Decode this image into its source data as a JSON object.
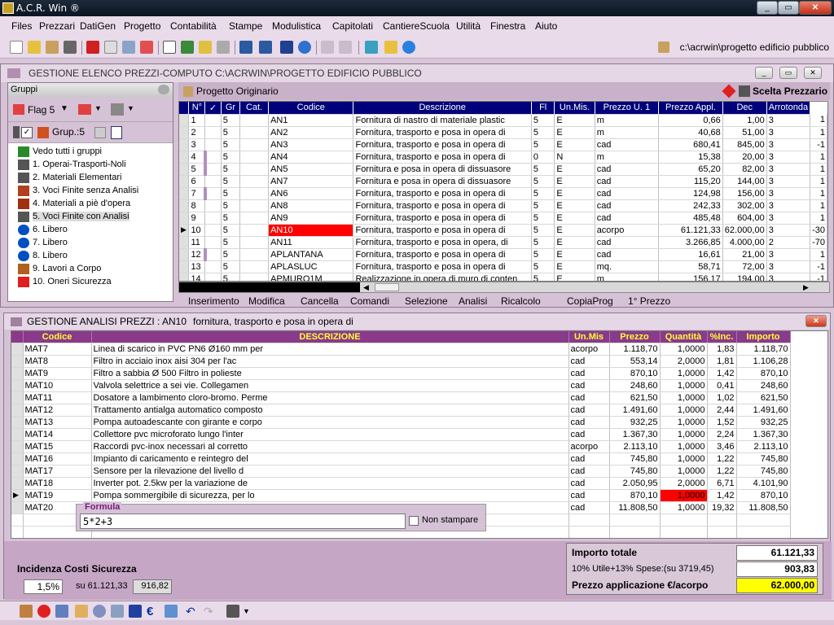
{
  "app": {
    "title": "A.C.R. Win  ®",
    "path": "c:\\acrwin\\progetto edificio pubblico"
  },
  "menu": [
    "Files",
    "Prezzari",
    "DatiGen",
    "Progetto",
    "Contabilità",
    "Stampe",
    "Modulistica",
    "Capitolati",
    "CantiereScuola",
    "Utilità",
    "Finestra",
    "Aiuto"
  ],
  "elenco": {
    "title": "GESTIONE ELENCO PREZZI-COMPUTO C:\\ACRWIN\\PROGETTO EDIFICIO PUBBLICO",
    "gruppi_label": "Gruppi",
    "flag_label": "Flag 5",
    "grup_label": "Grup.:5",
    "progetto_label": "Progetto Originario",
    "scelta_label": "Scelta Prezzario",
    "tree": [
      "Vedo tutti i gruppi",
      "1. Operai-Trasporti-Noli",
      "2. Materiali Elementari",
      "3. Voci Finite senza Analisi",
      "4. Materiali a piè d'opera",
      "5. Voci Finite con Analisi",
      "6. Libero",
      "7. Libero",
      "8. Libero",
      "9. Lavori a Corpo",
      "10. Oneri Sicurezza"
    ],
    "columns": [
      "N°",
      "✓",
      "Gr",
      "Cat.",
      "Codice",
      "Descrizione",
      "Fl",
      "Un.Mis.",
      "Prezzo U. 1",
      "Prezzo Appl.",
      "Dec",
      "Arrotonda"
    ],
    "rows": [
      [
        "1",
        "5",
        "AN1",
        "Fornitura di nastro di materiale plastic",
        "5",
        "E",
        "m",
        "0,66",
        "1,00",
        "3",
        "1"
      ],
      [
        "2",
        "5",
        "AN2",
        "Fornitura, trasporto e posa in opera di",
        "5",
        "E",
        "m",
        "40,68",
        "51,00",
        "3",
        "1"
      ],
      [
        "3",
        "5",
        "AN3",
        "Fornitura, trasporto e posa in opera di",
        "5",
        "E",
        "cad",
        "680,41",
        "845,00",
        "3",
        "-1"
      ],
      [
        "4",
        "5",
        "AN4",
        "Fornitura, trasporto e posa in opera di",
        "0",
        "N",
        "m",
        "15,38",
        "20,00",
        "3",
        "1"
      ],
      [
        "5",
        "5",
        "AN5",
        "Fornitura e posa in opera di dissuasore",
        "5",
        "E",
        "cad",
        "65,20",
        "82,00",
        "3",
        "1"
      ],
      [
        "6",
        "5",
        "AN7",
        "Fornitura e posa in opera di dissuasore",
        "5",
        "E",
        "cad",
        "115,20",
        "144,00",
        "3",
        "1"
      ],
      [
        "7",
        "5",
        "AN6",
        "Fornitura, trasporto e posa in opera di",
        "5",
        "E",
        "cad",
        "124,98",
        "156,00",
        "3",
        "1"
      ],
      [
        "8",
        "5",
        "AN8",
        "Fornitura, trasporto e posa in opera di",
        "5",
        "E",
        "cad",
        "242,33",
        "302,00",
        "3",
        "1"
      ],
      [
        "9",
        "5",
        "AN9",
        "Fornitura, trasporto e posa in opera di",
        "5",
        "E",
        "cad",
        "485,48",
        "604,00",
        "3",
        "1"
      ],
      [
        "10",
        "5",
        "AN10",
        "Fornitura, trasporto e posa in opera di",
        "5",
        "E",
        "acorpo",
        "61.121,33",
        "62.000,00",
        "3",
        "-30"
      ],
      [
        "11",
        "5",
        "AN11",
        "Fornitura, trasporto e posa in opera, di",
        "5",
        "E",
        "cad",
        "3.266,85",
        "4.000,00",
        "2",
        "-70"
      ],
      [
        "12",
        "5",
        "APLANTANA",
        "Fornitura, trasporto e posa in opera di",
        "5",
        "E",
        "cad",
        "16,61",
        "21,00",
        "3",
        "1"
      ],
      [
        "13",
        "5",
        "APLASLUC",
        "Fornitura, trasporto e posa in opera di",
        "5",
        "E",
        "mq.",
        "58,71",
        "72,00",
        "3",
        "-1"
      ],
      [
        "14",
        "5",
        "APMURO1M",
        "Realizzazione in opera di muro di conten",
        "5",
        "E",
        "m",
        "156,17",
        "194,00",
        "3",
        "-1"
      ]
    ],
    "bottom_menu": [
      "Inserimento",
      "Modifica",
      "Cancella",
      "Comandi",
      "Selezione",
      "Analisi",
      "Ricalcolo",
      "CopiaProg",
      "1° Prezzo"
    ]
  },
  "analisi": {
    "title": "GESTIONE ANALISI PREZZI :",
    "code": "AN10",
    "desc": "fornitura, trasporto e posa in opera di",
    "columns": [
      "Codice",
      "DESCRIZIONE",
      "Un.Mis",
      "Prezzo",
      "Quantità",
      "%Inc.",
      "Importo"
    ],
    "rows": [
      [
        "MAT7",
        "Linea di scarico in PVC PN6 Ø160 mm per",
        "acorpo",
        "1.118,70",
        "1,0000",
        "1,83",
        "1.118,70"
      ],
      [
        "MAT8",
        "Filtro in acciaio inox aisi 304 per l'ac",
        "cad",
        "553,14",
        "2,0000",
        "1,81",
        "1.106,28"
      ],
      [
        "MAT9",
        "Filtro a sabbia Ø 500 Filtro in polieste",
        "cad",
        "870,10",
        "1,0000",
        "1,42",
        "870,10"
      ],
      [
        "MAT10",
        "Valvola selettrice a sei vie. Collegamen",
        "cad",
        "248,60",
        "1,0000",
        "0,41",
        "248,60"
      ],
      [
        "MAT11",
        "Dosatore a lambimento cloro-bromo. Perme",
        "cad",
        "621,50",
        "1,0000",
        "1,02",
        "621,50"
      ],
      [
        "MAT12",
        "Trattamento antialga automatico composto",
        "cad",
        "1.491,60",
        "1,0000",
        "2,44",
        "1.491,60"
      ],
      [
        "MAT13",
        "Pompa autoadescante con girante e corpo",
        "cad",
        "932,25",
        "1,0000",
        "1,52",
        "932,25"
      ],
      [
        "MAT14",
        "Collettore pvc microforato lungo l'inter",
        "cad",
        "1.367,30",
        "1,0000",
        "2,24",
        "1.367,30"
      ],
      [
        "MAT15",
        "Raccordi pvc-inox necessari al corretto",
        "acorpo",
        "2.113,10",
        "1,0000",
        "3,46",
        "2.113,10"
      ],
      [
        "MAT16",
        "Impianto di caricamento e reintegro del",
        "cad",
        "745,80",
        "1,0000",
        "1,22",
        "745,80"
      ],
      [
        "MAT17",
        "Sensore per la rilevazione del livello d",
        "cad",
        "745,80",
        "1,0000",
        "1,22",
        "745,80"
      ],
      [
        "MAT18",
        "Inverter pot. 2.5kw per la variazione de",
        "cad",
        "2.050,95",
        "2,0000",
        "6,71",
        "4.101,90"
      ],
      [
        "MAT19",
        "Pompa sommergibile di sicurezza, per lo",
        "cad",
        "870,10",
        "1,0000",
        "1,42",
        "870,10"
      ],
      [
        "MAT20",
        "",
        "cad",
        "11.808,50",
        "1,0000",
        "19,32",
        "11.808,50"
      ]
    ],
    "formula_label": "Formula",
    "formula_value": "5*2+3",
    "non_stampare": "Non stampare",
    "incidenza_label": "Incidenza Costi Sicurezza",
    "incidenza_pct": "1,5%",
    "incidenza_su": "su 61.121,33",
    "incidenza_val": "916,82",
    "importo_totale_label": "Importo totale",
    "importo_totale": "61.121,33",
    "utile_label": "10% Utile+13% Spese:(su 3719,45)",
    "utile_val": "903,83",
    "prezzo_app_label": "Prezzo applicazione   €/acorpo",
    "prezzo_app": "62.000,00"
  },
  "colors": {
    "header_blue": "#00007a",
    "header_purple": "#8a3a8a",
    "highlight_red": "#ff0000",
    "yellow": "#ffff00"
  }
}
